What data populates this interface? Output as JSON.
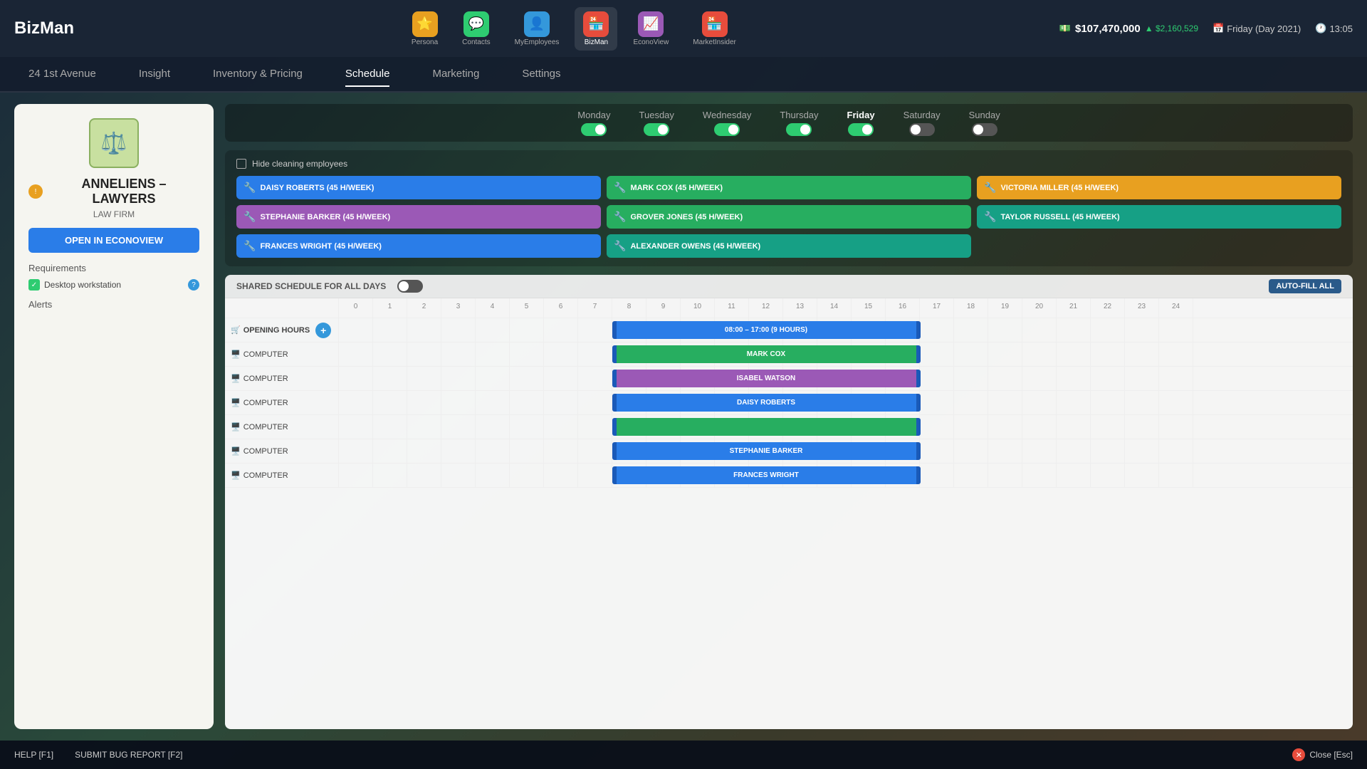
{
  "app": {
    "title": "BizMan"
  },
  "topbar": {
    "money": "$107,470,000",
    "money_change": "▲ $2,160,529",
    "date": "Friday (Day 2021)",
    "time": "13:05",
    "nav_items": [
      {
        "id": "persona",
        "label": "Persona",
        "icon": "⭐",
        "color": "#e8a020"
      },
      {
        "id": "contacts",
        "label": "Contacts",
        "icon": "💬",
        "color": "#2ecc71"
      },
      {
        "id": "myemployees",
        "label": "MyEmployees",
        "icon": "👤",
        "color": "#3498db"
      },
      {
        "id": "bizman",
        "label": "BizMan",
        "icon": "🏪",
        "color": "#e74c3c",
        "active": true
      },
      {
        "id": "econoview",
        "label": "EconoView",
        "icon": "📈",
        "color": "#9b59b6"
      },
      {
        "id": "marketinsider",
        "label": "MarketInsider",
        "icon": "🏪",
        "color": "#e74c3c"
      }
    ]
  },
  "secondary_nav": [
    {
      "id": "address",
      "label": "24 1st Avenue"
    },
    {
      "id": "insight",
      "label": "Insight"
    },
    {
      "id": "inventory",
      "label": "Inventory & Pricing"
    },
    {
      "id": "schedule",
      "label": "Schedule",
      "active": true
    },
    {
      "id": "marketing",
      "label": "Marketing"
    },
    {
      "id": "settings",
      "label": "Settings"
    }
  ],
  "company": {
    "name": "ANNELIENS – LAWYERS",
    "type": "LAW FIRM",
    "open_btn": "OPEN IN ECONOVIEW",
    "requirements": "Requirements",
    "req_item": "Desktop workstation",
    "alerts": "Alerts"
  },
  "days": [
    {
      "name": "Monday",
      "state": "on"
    },
    {
      "name": "Tuesday",
      "state": "on"
    },
    {
      "name": "Wednesday",
      "state": "on"
    },
    {
      "name": "Thursday",
      "state": "on"
    },
    {
      "name": "Friday",
      "state": "on",
      "active": true
    },
    {
      "name": "Saturday",
      "state": "off"
    },
    {
      "name": "Sunday",
      "state": "off"
    }
  ],
  "hide_cleaning": "Hide cleaning employees",
  "employees": [
    {
      "name": "DAISY ROBERTS (45 H/WEEK)",
      "color": "chip-blue"
    },
    {
      "name": "MARK COX (45 H/WEEK)",
      "color": "chip-green"
    },
    {
      "name": "VICTORIA MILLER (45 H/WEEK)",
      "color": "chip-orange"
    },
    {
      "name": "STEPHANIE BARKER (45 H/WEEK)",
      "color": "chip-purple"
    },
    {
      "name": "GROVER JONES (45 H/WEEK)",
      "color": "chip-green"
    },
    {
      "name": "TAYLOR RUSSELL (45 H/WEEK)",
      "color": "chip-teal"
    },
    {
      "name": "FRANCES WRIGHT (45 H/WEEK)",
      "color": "chip-blue"
    },
    {
      "name": "ALEXANDER OWENS (45 H/WEEK)",
      "color": "chip-teal"
    }
  ],
  "shared_schedule_label": "SHARED SCHEDULE FOR ALL DAYS",
  "auto_fill_label": "AUTO-FILL ALL",
  "hour_cols": [
    "0",
    "1",
    "2",
    "3",
    "4",
    "5",
    "6",
    "7",
    "8",
    "9",
    "10",
    "11",
    "12",
    "13",
    "14",
    "15",
    "16",
    "17",
    "18",
    "19",
    "20",
    "21",
    "22",
    "23",
    "24"
  ],
  "schedule_rows": [
    {
      "type": "opening",
      "label": "OPENING HOURS",
      "bar_label": "08:00 – 17:00 (9 HOURS)",
      "bar_color": "bar-blue",
      "bar_start": 8,
      "bar_end": 17
    },
    {
      "type": "computer",
      "label": "COMPUTER",
      "bar_label": "MARK COX",
      "bar_color": "bar-green",
      "bar_start": 8,
      "bar_end": 17
    },
    {
      "type": "computer",
      "label": "COMPUTER",
      "bar_label": "ISABEL WATSON",
      "bar_color": "bar-purple",
      "bar_start": 8,
      "bar_end": 17
    },
    {
      "type": "computer",
      "label": "COMPUTER",
      "bar_label": "DAISY ROBERTS",
      "bar_color": "bar-blue",
      "bar_start": 8,
      "bar_end": 17
    },
    {
      "type": "computer",
      "label": "COMPUTER",
      "bar_label": "",
      "bar_color": "bar-green",
      "bar_start": 8,
      "bar_end": 17
    },
    {
      "type": "computer",
      "label": "COMPUTER",
      "bar_label": "STEPHANIE BARKER",
      "bar_color": "bar-blue",
      "bar_start": 8,
      "bar_end": 17
    },
    {
      "type": "computer",
      "label": "COMPUTER",
      "bar_label": "FRANCES WRIGHT",
      "bar_color": "bar-blue",
      "bar_start": 8,
      "bar_end": 17
    }
  ],
  "bottom": {
    "help": "HELP [F1]",
    "bug": "SUBMIT BUG REPORT [F2]",
    "close": "Close [Esc]"
  }
}
